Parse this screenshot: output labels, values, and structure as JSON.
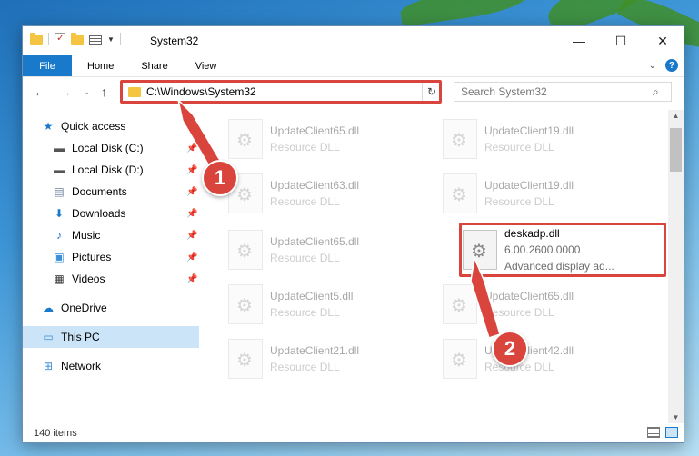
{
  "window": {
    "title": "System32",
    "controls": {
      "minimize": "—",
      "maximize": "☐",
      "close": "✕"
    }
  },
  "ribbon": {
    "tabs": [
      {
        "label": "File"
      },
      {
        "label": "Home"
      },
      {
        "label": "Share"
      },
      {
        "label": "View"
      }
    ]
  },
  "navigation": {
    "address_path": "C:\\Windows\\System32",
    "search_placeholder": "Search System32"
  },
  "sidebar": {
    "items": [
      {
        "label": "Quick access",
        "icon": "star-icon",
        "pinned": false
      },
      {
        "label": "Local Disk (C:)",
        "icon": "drive-icon",
        "pinned": true
      },
      {
        "label": "Local Disk (D:)",
        "icon": "drive-icon",
        "pinned": true
      },
      {
        "label": "Documents",
        "icon": "documents-icon",
        "pinned": true
      },
      {
        "label": "Downloads",
        "icon": "download-icon",
        "pinned": true
      },
      {
        "label": "Music",
        "icon": "music-icon",
        "pinned": true
      },
      {
        "label": "Pictures",
        "icon": "pictures-icon",
        "pinned": true
      },
      {
        "label": "Videos",
        "icon": "videos-icon",
        "pinned": true
      },
      {
        "label": "OneDrive",
        "icon": "cloud-icon",
        "pinned": false
      },
      {
        "label": "This PC",
        "icon": "computer-icon",
        "pinned": false,
        "selected": true
      },
      {
        "label": "Network",
        "icon": "network-icon",
        "pinned": false
      }
    ]
  },
  "files": [
    {
      "name": "UpdateClient65.dll",
      "type": "Resource DLL"
    },
    {
      "name": "UpdateClient19.dll",
      "type": "Resource DLL"
    },
    {
      "name": "UpdateClient63.dll",
      "type": "Resource DLL"
    },
    {
      "name": "UpdateClient19.dll",
      "type": "Resource DLL"
    },
    {
      "name": "UpdateClient65.dll",
      "type": "Resource DLL"
    },
    {
      "name": "deskadp.dll",
      "version": "6.00.2600.0000",
      "description": "Advanced display ad...",
      "highlighted": true
    },
    {
      "name": "UpdateClient5.dll",
      "type": "Resource DLL"
    },
    {
      "name": "UpdateClient65.dll",
      "type": "Resource DLL"
    },
    {
      "name": "UpdateClient21.dll",
      "type": "Resource DLL"
    },
    {
      "name": "UpdateClient42.dll",
      "type": "Resource DLL"
    }
  ],
  "status": {
    "item_count": "140 items"
  },
  "callouts": {
    "step1": "1",
    "step2": "2"
  },
  "colors": {
    "accent": "#1979ca",
    "highlight": "#d9453d",
    "selection": "#cce4f7"
  }
}
